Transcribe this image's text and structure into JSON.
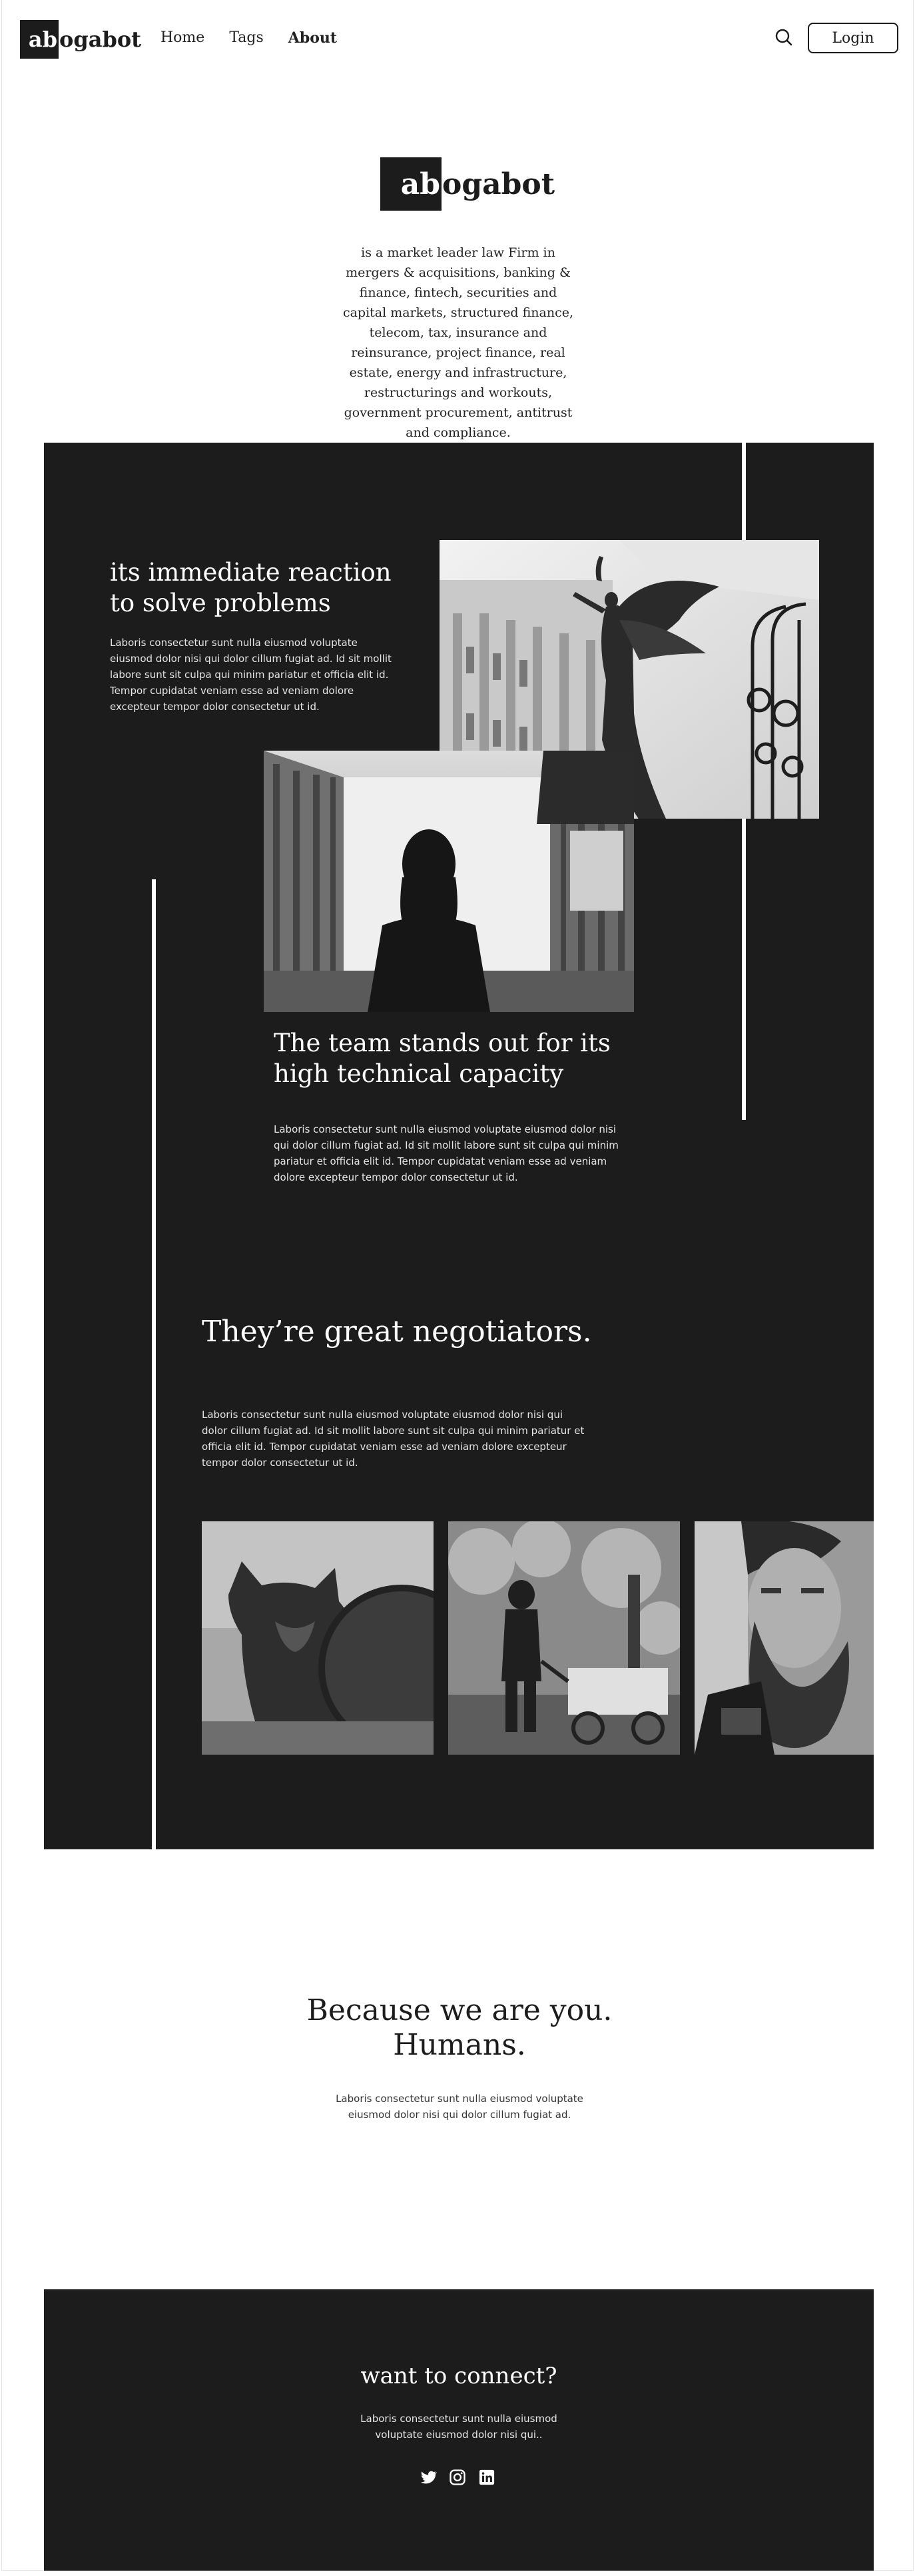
{
  "header": {
    "logo_mark": "ab",
    "logo_rest": "ogabot",
    "nav": [
      {
        "label": "Home"
      },
      {
        "label": "Tags"
      },
      {
        "label": "About"
      }
    ],
    "login_label": "Login"
  },
  "hero": {
    "logo_mark": "ab",
    "logo_rest": "ogabot",
    "description": "is a market leader law Firm in mergers & acquisitions, banking & finance, fintech, securities and capital markets, structured finance, telecom, tax, insurance and reinsurance, project finance, real estate, energy and infrastructure, restructurings and workouts, government procurement, antitrust and compliance."
  },
  "sections": {
    "reaction": {
      "title": "its immediate reaction to solve problems",
      "text": "Laboris consectetur sunt nulla eiusmod voluptate eiusmod dolor nisi qui dolor cillum fugiat ad. Id sit mollit labore sunt sit culpa qui minim pariatur et officia elit id. Tempor cupidatat veniam esse ad veniam dolore excepteur tempor dolor consectetur ut id."
    },
    "team": {
      "title": "The team stands out for its high technical capacity",
      "text": "Laboris consectetur sunt nulla eiusmod voluptate eiusmod dolor nisi qui dolor cillum fugiat ad. Id sit mollit labore sunt sit culpa qui minim pariatur et officia elit id. Tempor cupidatat veniam esse ad veniam dolore excepteur tempor dolor consectetur ut id."
    },
    "negotiators": {
      "title": "They’re great negotiators.",
      "text": "Laboris consectetur sunt nulla eiusmod voluptate eiusmod dolor nisi qui dolor cillum fugiat ad. Id sit mollit labore sunt sit culpa qui minim pariatur et officia elit id. Tempor cupidatat veniam esse ad veniam dolore excepteur tempor dolor consectetur ut id."
    }
  },
  "humans": {
    "title_line1": "Because we are you.",
    "title_line2": "Humans.",
    "text": "Laboris consectetur sunt nulla eiusmod voluptate eiusmod dolor nisi qui dolor cillum fugiat ad."
  },
  "footer": {
    "title": "want to connect?",
    "text": "Laboris consectetur sunt nulla eiusmod voluptate eiusmod dolor nisi qui..",
    "social": [
      "twitter-icon",
      "instagram-icon",
      "linkedin-icon"
    ]
  },
  "colors": {
    "dark": "#1c1c1c",
    "light": "#ffffff"
  }
}
